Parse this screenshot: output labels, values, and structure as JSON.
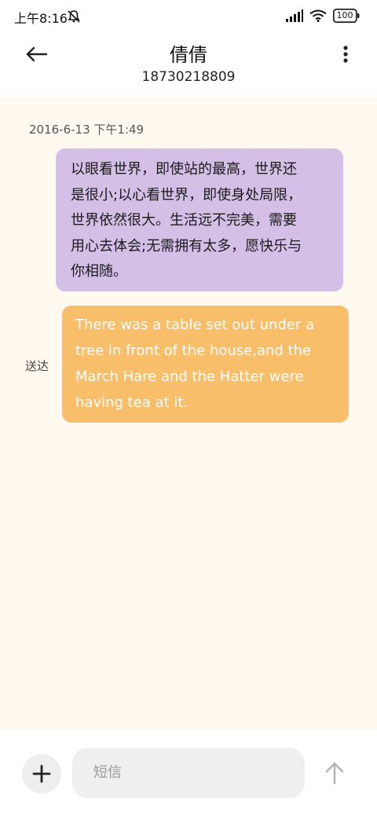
{
  "status_bar": {
    "time": "上午8:16",
    "battery": "100",
    "icons": [
      "mute-icon",
      "signal-icon",
      "wifi-icon",
      "battery-icon"
    ]
  },
  "header": {
    "name": "倩倩",
    "number": "18730218809",
    "icons": [
      "back-arrow-icon",
      "more-vertical-icon"
    ]
  },
  "conversation": {
    "timestamp": "2016-6-13 下午1:49",
    "messages": [
      {
        "direction": "received",
        "lines": [
          "以眼看世界，即使站的最高，世界还",
          "是很小;以心看世界，即使身处局限，",
          "世界依然很大。生活远不完美，需要",
          "用心去体会;无需拥有太多，愿快乐与",
          "你相随。"
        ]
      },
      {
        "direction": "sent",
        "status": "送达",
        "lines": [
          "There was a table set out under a",
          "tree in front of the house,and the",
          "March Hare and the Hatter were",
          "having tea at it."
        ]
      }
    ]
  },
  "input_bar": {
    "placeholder": "短信",
    "icons": [
      "plus-icon",
      "send-arrow-icon"
    ]
  },
  "colors": {
    "conversation_bg": "#fff9f0",
    "received_bubble": "#d4bfe6",
    "sent_bubble": "#f8be6a",
    "sent_text": "#ffffff",
    "input_bg": "#efefef"
  }
}
